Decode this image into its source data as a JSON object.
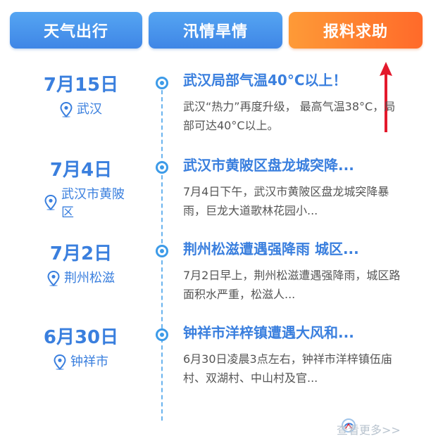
{
  "tabs": [
    {
      "label": "天气出行"
    },
    {
      "label": "汛情旱情"
    },
    {
      "label": "报料求助"
    }
  ],
  "events": [
    {
      "date": "7月15日",
      "location": "武汉",
      "title": "武汉局部气温40°C以上！",
      "summary": "武汉“热力”再度升级，  最高气温38°C，局部可达40°C以上。"
    },
    {
      "date": "7月4日",
      "location": "武汉市黄陂区",
      "title": "武汉市黄陂区盘龙城突降...",
      "summary": "7月4日下午，武汉市黄陂区盘龙城突降暴雨，巨龙大道歌林花园小..."
    },
    {
      "date": "7月2日",
      "location": "荆州松滋",
      "title": "荆州松滋遭遇强降雨 城区...",
      "summary": "7月2日早上，荆州松滋遭遇强降雨，城区路面积水严重，松滋人..."
    },
    {
      "date": "6月30日",
      "location": "钟祥市",
      "title": "钟祥市洋梓镇遭遇大风和...",
      "summary": "6月30日凌晨3点左右，钟祥市洋梓镇伍庙村、双湖村、中山村及官..."
    }
  ],
  "footer": {
    "more_label": "查看更多>>"
  },
  "colors": {
    "accent_blue": "#3a7fde",
    "tab_orange": "#ff7a30",
    "arrow_red": "#e3192c"
  },
  "icons": {
    "location": "location-pin-icon"
  }
}
